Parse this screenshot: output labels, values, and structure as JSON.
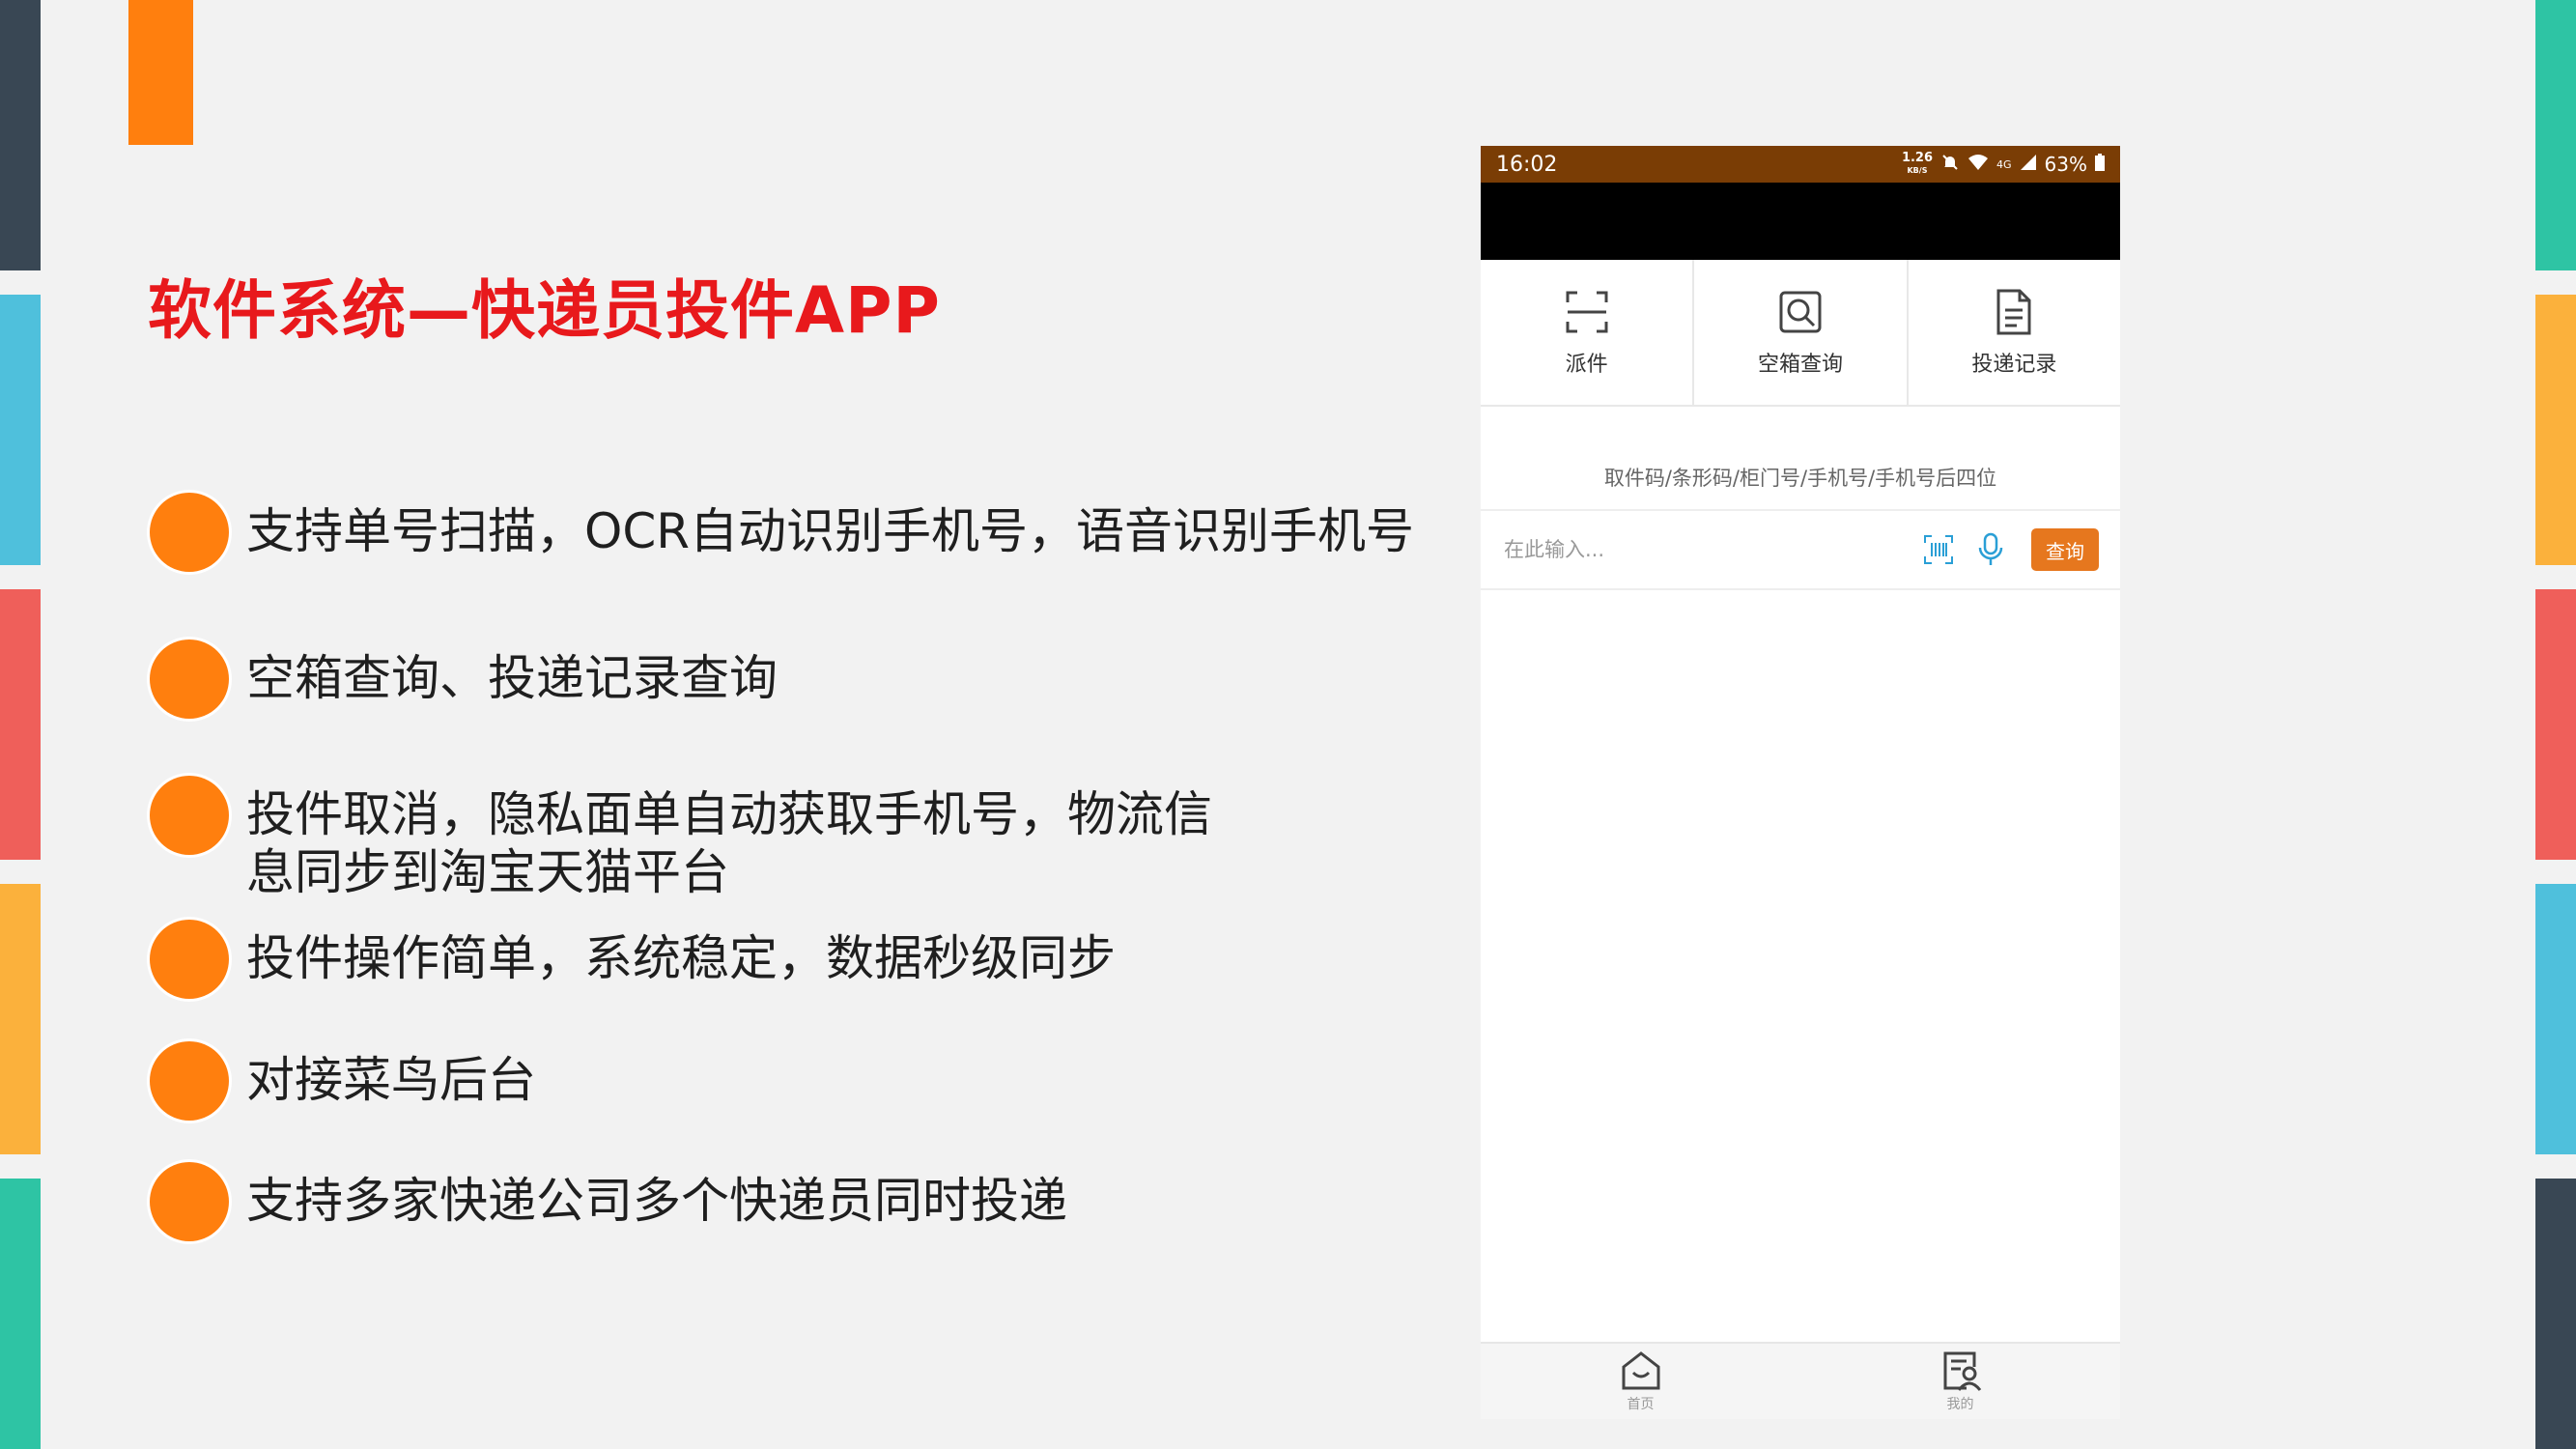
{
  "slide": {
    "title": "软件系统—快递员投件APP",
    "colors": {
      "accent": "#ff7f0e",
      "title": "#e8191c"
    },
    "bullets": [
      "支持单号扫描，OCR自动识别手机号，语音识别手机号",
      "空箱查询、投递记录查询",
      "投件取消，隐私面单自动获取手机号，物流信息同步到淘宝天猫平台",
      "投件操作简单，系统稳定，数据秒级同步",
      "对接菜鸟后台",
      "支持多家快递公司多个快递员同时投递"
    ]
  },
  "phone": {
    "status": {
      "time": "16:02",
      "speed_value": "1.26",
      "speed_unit": "KB/S",
      "network": "4G",
      "battery": "63%"
    },
    "tabs": [
      {
        "label": "派件",
        "icon": "scan-icon"
      },
      {
        "label": "空箱查询",
        "icon": "box-search-icon"
      },
      {
        "label": "投递记录",
        "icon": "document-icon"
      }
    ],
    "search": {
      "hint": "取件码/条形码/柜门号/手机号/手机号后四位",
      "placeholder": "在此输入...",
      "button": "查询"
    },
    "bottom_nav": [
      {
        "label": "首页",
        "icon": "home-icon"
      },
      {
        "label": "我的",
        "icon": "profile-icon"
      }
    ],
    "colors": {
      "status_bar": "#7a3d05",
      "button": "#e6771e"
    }
  }
}
